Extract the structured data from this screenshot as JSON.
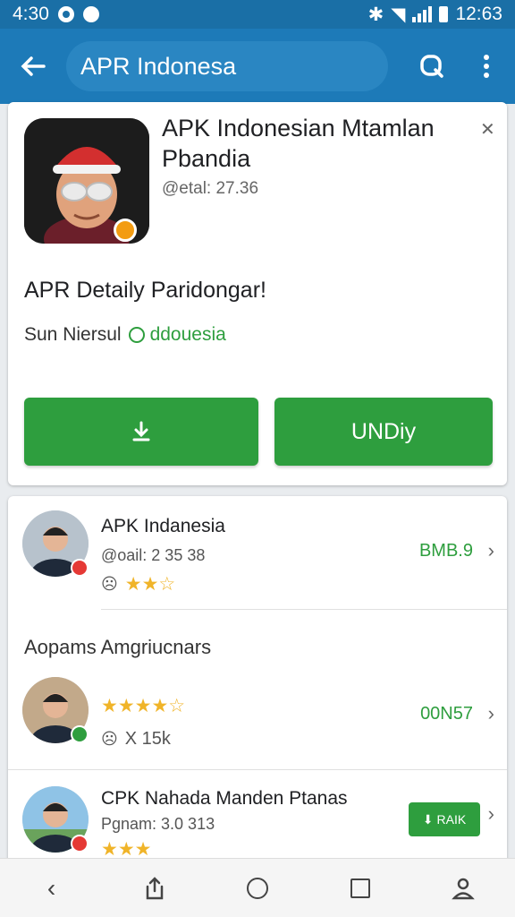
{
  "status_bar": {
    "time": "4:30",
    "right_time": "12:63"
  },
  "app_bar": {
    "search_text": "APR Indonesa"
  },
  "top_card": {
    "title": "APK Indonesian Mtamlan Pbandia",
    "meta": "@etal: 27.36",
    "details_heading": "APR Detaily Paridongar!",
    "publisher_prefix": "Sun Niersul",
    "publisher_link": "ddouesia",
    "install_icon": "download-arrow-icon",
    "open_label": "UNDiy"
  },
  "colors": {
    "primary": "#1d7ab8",
    "status": "#1a6fa6",
    "green": "#2e9e3e",
    "star": "#f0b429"
  },
  "list": {
    "section_label": "Aopams Amgriucnars",
    "items": [
      {
        "title": "APK Indanesia",
        "meta": "@oail: 2 35 38",
        "rating": 2.5,
        "right_label": "BMB.9"
      },
      {
        "rating": 4.5,
        "sub": "X 15k",
        "right_label": "00N57"
      },
      {
        "title": "CPK Nahada Manden Ptanas",
        "meta": "Pgnam: 3.0 313",
        "rating": 3.0,
        "button_label": "RAIK"
      }
    ]
  }
}
